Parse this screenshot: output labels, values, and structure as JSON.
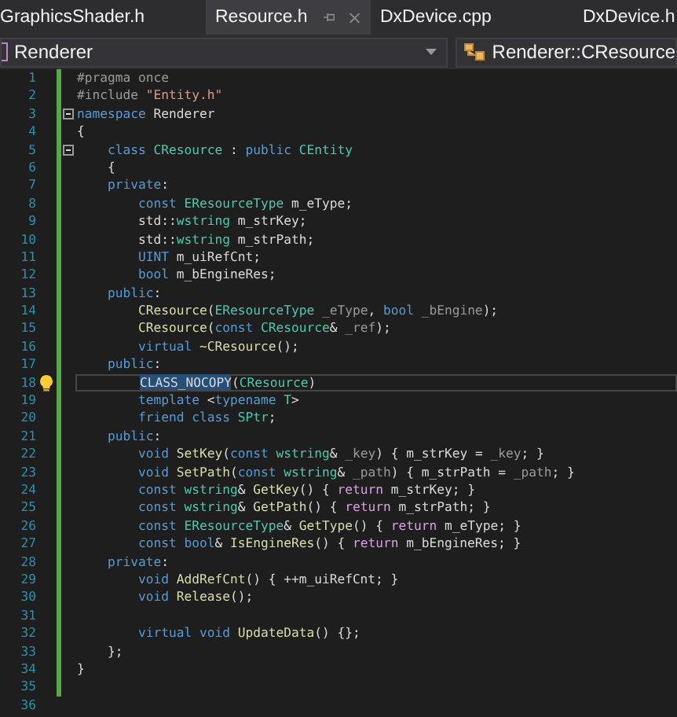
{
  "tabs": [
    {
      "label": "GraphicsShader.h",
      "selected": false
    },
    {
      "label": "Resource.h",
      "selected": true
    },
    {
      "label": "DxDevice.cpp",
      "selected": false
    },
    {
      "label": "DxDevice.h",
      "selected": false
    }
  ],
  "navigation": {
    "scope": "Renderer",
    "member": "Renderer::CResource"
  },
  "editor": {
    "lines": [
      {
        "n": "1",
        "fold": false,
        "current": false,
        "hint": false,
        "tokens": [
          {
            "kind": "pp",
            "text": "#pragma once"
          }
        ]
      },
      {
        "n": "2",
        "fold": false,
        "current": false,
        "hint": false,
        "tokens": [
          {
            "kind": "pp",
            "text": "#include "
          },
          {
            "kind": "str",
            "text": "\"Entity.h\""
          }
        ]
      },
      {
        "n": "3",
        "fold": true,
        "current": false,
        "hint": false,
        "tokens": [
          {
            "kind": "kw",
            "text": "namespace"
          },
          {
            "kind": "txt",
            "text": " Renderer"
          }
        ]
      },
      {
        "n": "4",
        "fold": false,
        "current": false,
        "hint": false,
        "tokens": [
          {
            "kind": "txt",
            "text": "{"
          }
        ]
      },
      {
        "n": "5",
        "fold": true,
        "current": false,
        "hint": false,
        "tokens": [
          {
            "kind": "kw",
            "text": "    class "
          },
          {
            "kind": "type",
            "text": "CResource"
          },
          {
            "kind": "txt",
            "text": " : "
          },
          {
            "kind": "kw",
            "text": "public "
          },
          {
            "kind": "type",
            "text": "CEntity"
          }
        ]
      },
      {
        "n": "6",
        "fold": false,
        "current": false,
        "hint": false,
        "tokens": [
          {
            "kind": "txt",
            "text": "    {"
          }
        ]
      },
      {
        "n": "7",
        "fold": false,
        "current": false,
        "hint": false,
        "tokens": [
          {
            "kind": "kw",
            "text": "    private"
          },
          {
            "kind": "txt",
            "text": ":"
          }
        ]
      },
      {
        "n": "8",
        "fold": false,
        "current": false,
        "hint": false,
        "tokens": [
          {
            "kind": "kw",
            "text": "        const "
          },
          {
            "kind": "type",
            "text": "EResourceType"
          },
          {
            "kind": "txt",
            "text": " m_eType;"
          }
        ]
      },
      {
        "n": "9",
        "fold": false,
        "current": false,
        "hint": false,
        "tokens": [
          {
            "kind": "txt",
            "text": "        std::"
          },
          {
            "kind": "type",
            "text": "wstring"
          },
          {
            "kind": "txt",
            "text": " m_strKey;"
          }
        ]
      },
      {
        "n": "10",
        "fold": false,
        "current": false,
        "hint": false,
        "tokens": [
          {
            "kind": "txt",
            "text": "        std::"
          },
          {
            "kind": "type",
            "text": "wstring"
          },
          {
            "kind": "txt",
            "text": " m_strPath;"
          }
        ]
      },
      {
        "n": "11",
        "fold": false,
        "current": false,
        "hint": false,
        "tokens": [
          {
            "kind": "kw",
            "text": "        UINT"
          },
          {
            "kind": "txt",
            "text": " m_uiRefCnt;"
          }
        ]
      },
      {
        "n": "12",
        "fold": false,
        "current": false,
        "hint": false,
        "tokens": [
          {
            "kind": "kw",
            "text": "        bool"
          },
          {
            "kind": "txt",
            "text": " m_bEngineRes;"
          }
        ]
      },
      {
        "n": "13",
        "fold": false,
        "current": false,
        "hint": false,
        "tokens": [
          {
            "kind": "kw",
            "text": "    public"
          },
          {
            "kind": "txt",
            "text": ":"
          }
        ]
      },
      {
        "n": "14",
        "fold": false,
        "current": false,
        "hint": false,
        "tokens": [
          {
            "kind": "fn",
            "text": "        CResource"
          },
          {
            "kind": "txt",
            "text": "("
          },
          {
            "kind": "type",
            "text": "EResourceType"
          },
          {
            "kind": "param",
            "text": " _eType"
          },
          {
            "kind": "txt",
            "text": ", "
          },
          {
            "kind": "kw",
            "text": "bool"
          },
          {
            "kind": "param",
            "text": " _bEngine"
          },
          {
            "kind": "txt",
            "text": ");"
          }
        ]
      },
      {
        "n": "15",
        "fold": false,
        "current": false,
        "hint": false,
        "tokens": [
          {
            "kind": "fn",
            "text": "        CResource"
          },
          {
            "kind": "txt",
            "text": "("
          },
          {
            "kind": "kw",
            "text": "const "
          },
          {
            "kind": "type",
            "text": "CResource"
          },
          {
            "kind": "txt",
            "text": "&"
          },
          {
            "kind": "param",
            "text": " _ref"
          },
          {
            "kind": "txt",
            "text": ");"
          }
        ]
      },
      {
        "n": "16",
        "fold": false,
        "current": false,
        "hint": false,
        "tokens": [
          {
            "kind": "kw",
            "text": "        virtual "
          },
          {
            "kind": "fn",
            "text": "~CResource"
          },
          {
            "kind": "txt",
            "text": "();"
          }
        ]
      },
      {
        "n": "17",
        "fold": false,
        "current": false,
        "hint": false,
        "tokens": [
          {
            "kind": "kw",
            "text": "    public"
          },
          {
            "kind": "txt",
            "text": ":"
          }
        ]
      },
      {
        "n": "18",
        "fold": false,
        "current": true,
        "hint": true,
        "tokens": [
          {
            "kind": "sel",
            "text": "        CLASS_NOCOPY"
          },
          {
            "kind": "txt",
            "text": "("
          },
          {
            "kind": "type",
            "text": "CResource"
          },
          {
            "kind": "txt",
            "text": ")"
          }
        ]
      },
      {
        "n": "19",
        "fold": false,
        "current": false,
        "hint": false,
        "tokens": [
          {
            "kind": "kw",
            "text": "        template "
          },
          {
            "kind": "txt",
            "text": "<"
          },
          {
            "kind": "kw",
            "text": "typename "
          },
          {
            "kind": "type",
            "text": "T"
          },
          {
            "kind": "txt",
            "text": ">"
          }
        ]
      },
      {
        "n": "20",
        "fold": false,
        "current": false,
        "hint": false,
        "tokens": [
          {
            "kind": "kw",
            "text": "        friend class "
          },
          {
            "kind": "type",
            "text": "SPtr"
          },
          {
            "kind": "txt",
            "text": ";"
          }
        ]
      },
      {
        "n": "21",
        "fold": false,
        "current": false,
        "hint": false,
        "tokens": [
          {
            "kind": "kw",
            "text": "    public"
          },
          {
            "kind": "txt",
            "text": ":"
          }
        ]
      },
      {
        "n": "22",
        "fold": false,
        "current": false,
        "hint": false,
        "tokens": [
          {
            "kind": "kw",
            "text": "        void "
          },
          {
            "kind": "fn",
            "text": "SetKey"
          },
          {
            "kind": "txt",
            "text": "("
          },
          {
            "kind": "kw",
            "text": "const "
          },
          {
            "kind": "type",
            "text": "wstring"
          },
          {
            "kind": "txt",
            "text": "&"
          },
          {
            "kind": "param",
            "text": " _key"
          },
          {
            "kind": "txt",
            "text": ") { m_strKey = "
          },
          {
            "kind": "param",
            "text": "_key"
          },
          {
            "kind": "txt",
            "text": "; }"
          }
        ]
      },
      {
        "n": "23",
        "fold": false,
        "current": false,
        "hint": false,
        "tokens": [
          {
            "kind": "kw",
            "text": "        void "
          },
          {
            "kind": "fn",
            "text": "SetPath"
          },
          {
            "kind": "txt",
            "text": "("
          },
          {
            "kind": "kw",
            "text": "const "
          },
          {
            "kind": "type",
            "text": "wstring"
          },
          {
            "kind": "txt",
            "text": "&"
          },
          {
            "kind": "param",
            "text": " _path"
          },
          {
            "kind": "txt",
            "text": ") { m_strPath = "
          },
          {
            "kind": "param",
            "text": "_path"
          },
          {
            "kind": "txt",
            "text": "; }"
          }
        ]
      },
      {
        "n": "24",
        "fold": false,
        "current": false,
        "hint": false,
        "tokens": [
          {
            "kind": "kw",
            "text": "        const "
          },
          {
            "kind": "type",
            "text": "wstring"
          },
          {
            "kind": "txt",
            "text": "& "
          },
          {
            "kind": "fn",
            "text": "GetKey"
          },
          {
            "kind": "txt",
            "text": "() { "
          },
          {
            "kind": "ctl",
            "text": "return"
          },
          {
            "kind": "txt",
            "text": " m_strKey; }"
          }
        ]
      },
      {
        "n": "25",
        "fold": false,
        "current": false,
        "hint": false,
        "tokens": [
          {
            "kind": "kw",
            "text": "        const "
          },
          {
            "kind": "type",
            "text": "wstring"
          },
          {
            "kind": "txt",
            "text": "& "
          },
          {
            "kind": "fn",
            "text": "GetPath"
          },
          {
            "kind": "txt",
            "text": "() { "
          },
          {
            "kind": "ctl",
            "text": "return"
          },
          {
            "kind": "txt",
            "text": " m_strPath; }"
          }
        ]
      },
      {
        "n": "26",
        "fold": false,
        "current": false,
        "hint": false,
        "tokens": [
          {
            "kind": "kw",
            "text": "        const "
          },
          {
            "kind": "type",
            "text": "EResourceType"
          },
          {
            "kind": "txt",
            "text": "& "
          },
          {
            "kind": "fn",
            "text": "GetType"
          },
          {
            "kind": "txt",
            "text": "() { "
          },
          {
            "kind": "ctl",
            "text": "return"
          },
          {
            "kind": "txt",
            "text": " m_eType; }"
          }
        ]
      },
      {
        "n": "27",
        "fold": false,
        "current": false,
        "hint": false,
        "tokens": [
          {
            "kind": "kw",
            "text": "        const bool"
          },
          {
            "kind": "txt",
            "text": "& "
          },
          {
            "kind": "fn",
            "text": "IsEngineRes"
          },
          {
            "kind": "txt",
            "text": "() { "
          },
          {
            "kind": "ctl",
            "text": "return"
          },
          {
            "kind": "txt",
            "text": " m_bEngineRes; }"
          }
        ]
      },
      {
        "n": "28",
        "fold": false,
        "current": false,
        "hint": false,
        "tokens": [
          {
            "kind": "kw",
            "text": "    private"
          },
          {
            "kind": "txt",
            "text": ":"
          }
        ]
      },
      {
        "n": "29",
        "fold": false,
        "current": false,
        "hint": false,
        "tokens": [
          {
            "kind": "kw",
            "text": "        void "
          },
          {
            "kind": "fn",
            "text": "AddRefCnt"
          },
          {
            "kind": "txt",
            "text": "() { ++m_uiRefCnt; }"
          }
        ]
      },
      {
        "n": "30",
        "fold": false,
        "current": false,
        "hint": false,
        "tokens": [
          {
            "kind": "kw",
            "text": "        void "
          },
          {
            "kind": "fn",
            "text": "Release"
          },
          {
            "kind": "txt",
            "text": "();"
          }
        ]
      },
      {
        "n": "31",
        "fold": false,
        "current": false,
        "hint": false
      },
      {
        "n": "32",
        "fold": false,
        "current": false,
        "hint": false,
        "tokens": [
          {
            "kind": "kw",
            "text": "        virtual void "
          },
          {
            "kind": "fn",
            "text": "UpdateData"
          },
          {
            "kind": "txt",
            "text": "() {};"
          }
        ]
      },
      {
        "n": "33",
        "fold": false,
        "current": false,
        "hint": false,
        "tokens": [
          {
            "kind": "txt",
            "text": "    };"
          }
        ]
      },
      {
        "n": "34",
        "fold": false,
        "current": false,
        "hint": false,
        "tokens": [
          {
            "kind": "txt",
            "text": "}"
          }
        ]
      },
      {
        "n": "35",
        "fold": false,
        "current": false,
        "hint": false
      },
      {
        "n": "36",
        "fold": false,
        "current": false,
        "hint": false
      }
    ]
  }
}
